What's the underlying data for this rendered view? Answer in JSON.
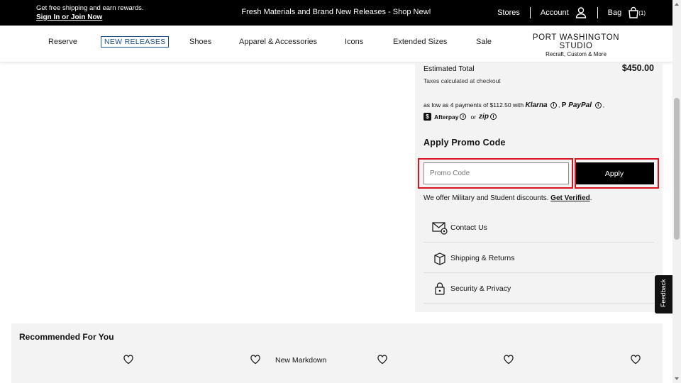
{
  "topbar": {
    "promo_line": "Get free shipping and earn rewards.",
    "signin_link": "Sign In or Join Now",
    "center_message": "Fresh Materials and Brand New Releases - Shop New!",
    "stores": "Stores",
    "account": "Account",
    "bag": "Bag",
    "bag_count": "(1)"
  },
  "nav": {
    "items": [
      "Reserve",
      "NEW RELEASES",
      "Shoes",
      "Apparel & Accessories",
      "Icons",
      "Extended Sizes",
      "Sale"
    ],
    "studio_title": "PORT WASHINGTON STUDIO",
    "studio_subtitle": "Recraft, Custom & More"
  },
  "summary": {
    "estimated_label": "Estimated Total",
    "estimated_value": "$450.00",
    "tax_note": "Taxes calculated at checkout",
    "pay_prefix": "as low as 4 payments of $112.50 with",
    "klarna": "Klarna",
    "paypal": "PayPal",
    "afterpay": "Afterpay",
    "or": "or",
    "zip": "zip",
    "promo_heading": "Apply Promo Code",
    "promo_placeholder": "Promo Code",
    "apply_label": "Apply",
    "discount_text": "We offer Military and Student discounts.",
    "verify_link": "Get Verified",
    "links": [
      "Contact Us",
      "Shipping & Returns",
      "Security & Privacy"
    ]
  },
  "feedback": "Feedback",
  "recommended": {
    "title": "Recommended For You",
    "badge": "New Markdown"
  },
  "colors": {
    "highlight": "#d8141d",
    "nav_accent": "#1f4e8c"
  }
}
